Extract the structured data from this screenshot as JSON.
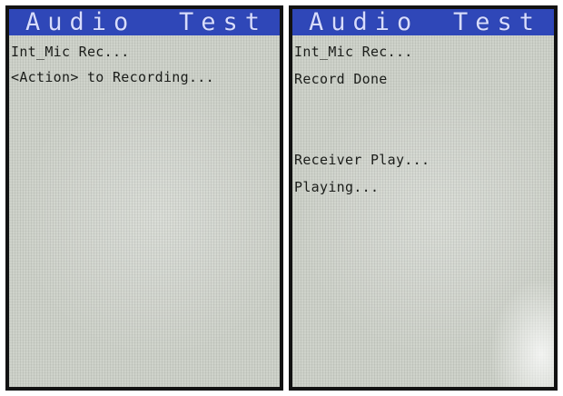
{
  "left_screen": {
    "title_words": [
      "Audio",
      "Test"
    ],
    "lines": [
      "Int_Mic Rec...",
      "<Action> to Recording..."
    ]
  },
  "right_screen": {
    "title_words": [
      "Audio",
      "Test"
    ],
    "lines": [
      "Int_Mic Rec...",
      "Record Done",
      "Receiver Play...",
      "Playing..."
    ]
  },
  "colors": {
    "title_bar": "#2f47b8",
    "title_text": "#d7dcff",
    "screen_bg": "#cfd3cb",
    "text": "#1b1d1a"
  }
}
